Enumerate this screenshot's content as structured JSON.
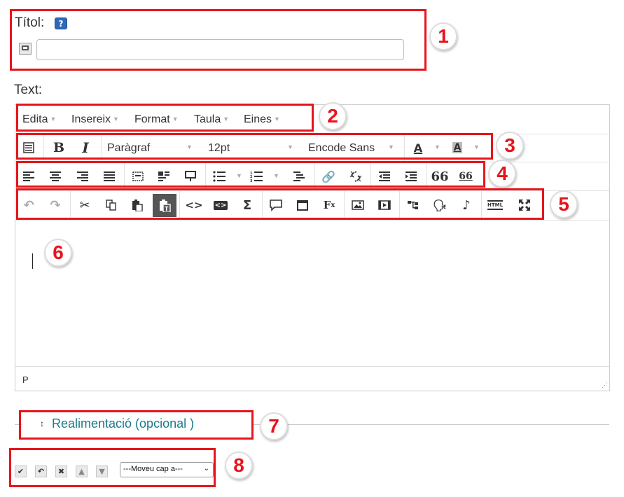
{
  "title_field": {
    "label": "Títol:",
    "help_icon": "help-icon",
    "lang_icon": "language-icon",
    "value": ""
  },
  "text_label": "Text:",
  "menubar": [
    "Edita",
    "Insereix",
    "Format",
    "Taula",
    "Eines"
  ],
  "toolbar": {
    "paragraph": "Paràgraf",
    "size": "12pt",
    "font": "Encode Sans",
    "font_color_letter": "A",
    "bg_color_letter": "A"
  },
  "statusbar": {
    "path": "P"
  },
  "feedback": {
    "arrow": "↕",
    "label": "Realimentació (opcional )"
  },
  "bottom": {
    "move_select": "---Moveu cap a---"
  },
  "markers": [
    "1",
    "2",
    "3",
    "4",
    "5",
    "6",
    "7",
    "8"
  ],
  "colors": {
    "accent_red": "#e8141c",
    "link_teal": "#1a7a8a"
  }
}
